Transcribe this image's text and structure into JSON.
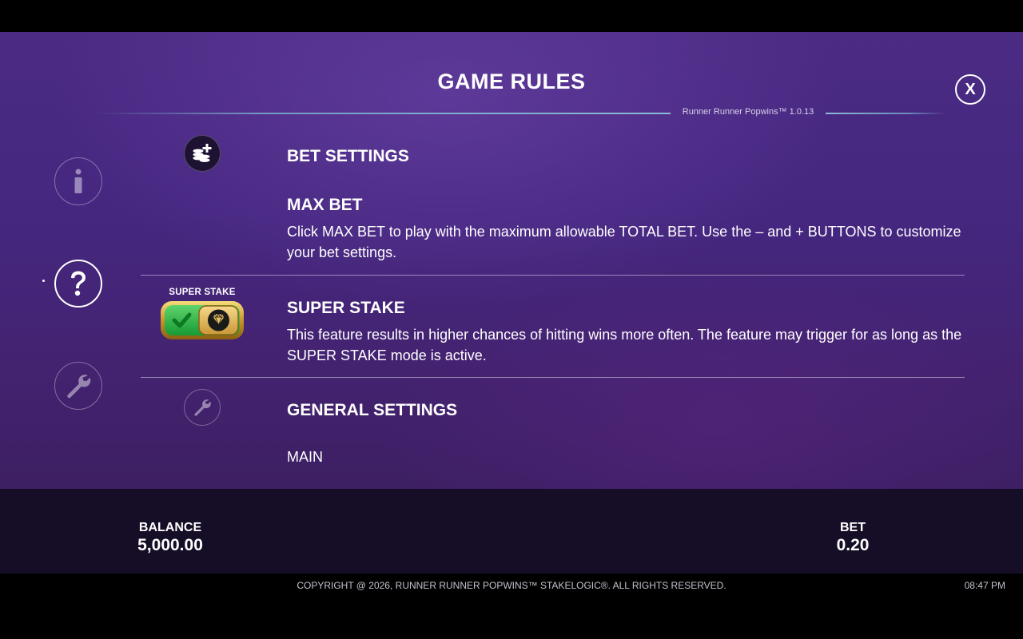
{
  "header": {
    "title": "GAME RULES",
    "version": "Runner Runner Popwins™ 1.0.13",
    "close_label": "X"
  },
  "nav": {
    "items": [
      {
        "name": "info",
        "icon": "info-icon",
        "active": false
      },
      {
        "name": "rules",
        "icon": "question-icon",
        "active": true
      },
      {
        "name": "settings",
        "icon": "wrench-icon",
        "active": false
      }
    ]
  },
  "sections": {
    "bet_settings": {
      "icon": "coins-plus-icon",
      "heading": "BET SETTINGS",
      "max_bet_heading": "MAX BET",
      "max_bet_text": "Click MAX BET to play with the maximum allowable TOTAL BET. Use the – and + BUTTONS to customize your bet settings."
    },
    "super_stake": {
      "badge_label": "SUPER STAKE",
      "icon": "super-stake-toggle-icon",
      "toggle_on": true,
      "heading": "SUPER STAKE",
      "text": "This feature results in higher chances of hitting wins more often. The feature may trigger for as long as the SUPER STAKE mode is active."
    },
    "general_settings": {
      "icon": "wrench-icon",
      "heading": "GENERAL SETTINGS",
      "main_label": "MAIN"
    }
  },
  "status_bar": {
    "balance_label": "BALANCE",
    "balance_value": "5,000.00",
    "bet_label": "BET",
    "bet_value": "0.20"
  },
  "footer": {
    "copyright": "COPYRIGHT @ 2026, RUNNER RUNNER POPWINS™ STAKELOGIC®. ALL RIGHTS RESERVED.",
    "time": "08:47 PM"
  },
  "colors": {
    "panel_top": "#4b2b84",
    "panel_bottom": "#3d1f63",
    "bottom_bar": "#160d26",
    "toggle_green": "#2db34a",
    "toggle_gold": "#d4a62e"
  }
}
